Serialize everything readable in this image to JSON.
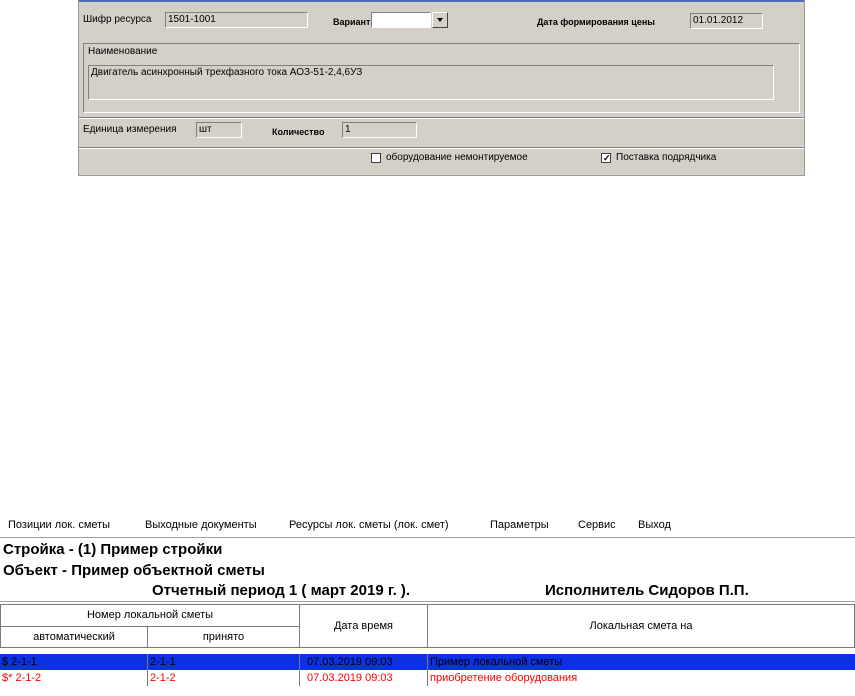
{
  "form": {
    "resource_code_label": "Шифр ресурса",
    "resource_code_value": "1501-1001",
    "variant_label": "Вариант",
    "variant_value": "",
    "price_date_label": "Дата формирования цены",
    "price_date_value": "01.01.2012",
    "name_label": "Наименование",
    "name_value": "Двигатель асинхронный трехфазного тока АОЗ-51-2,4,6УЗ",
    "unit_label": "Единица измерения",
    "unit_value": "шт",
    "quantity_label": "Количество",
    "quantity_value": "1",
    "equipment_label": "оборудование немонтируемое",
    "equipment_checked": false,
    "contractor_label": "Поставка подрядчика",
    "contractor_checked": true
  },
  "menu": [
    "Позиции лок. сметы",
    "Выходные документы",
    "Ресурсы лок. сметы (лок. смет)",
    "Параметры",
    "Сервис",
    "Выход"
  ],
  "header": {
    "construction": "Стройка - (1) Пример стройки",
    "object": "Объект - Пример объектной сметы",
    "period": "Отчетный период 1   ( март  2019 г. ).",
    "executor": "Исполнитель Сидоров П.П."
  },
  "table": {
    "group_header": "Номер локальной сметы",
    "col_auto": "автоматический",
    "col_accepted": "принято",
    "col_datetime": "Дата время",
    "col_estimate": "Локальная смета на",
    "rows": [
      {
        "auto": "$ 2-1-1",
        "accepted": "2-1-1",
        "datetime": "07.03.2019 09:03",
        "estimate": "Пример локальной сметы"
      },
      {
        "auto": "$* 2-1-2",
        "accepted": "2-1-2",
        "datetime": "07.03.2019 09:03",
        "estimate": "приобретение оборудования"
      }
    ]
  },
  "colors": {
    "panel_bg": "#d4d0c8",
    "selection": "#0c31e3",
    "highlight_text": "#ff0000"
  }
}
